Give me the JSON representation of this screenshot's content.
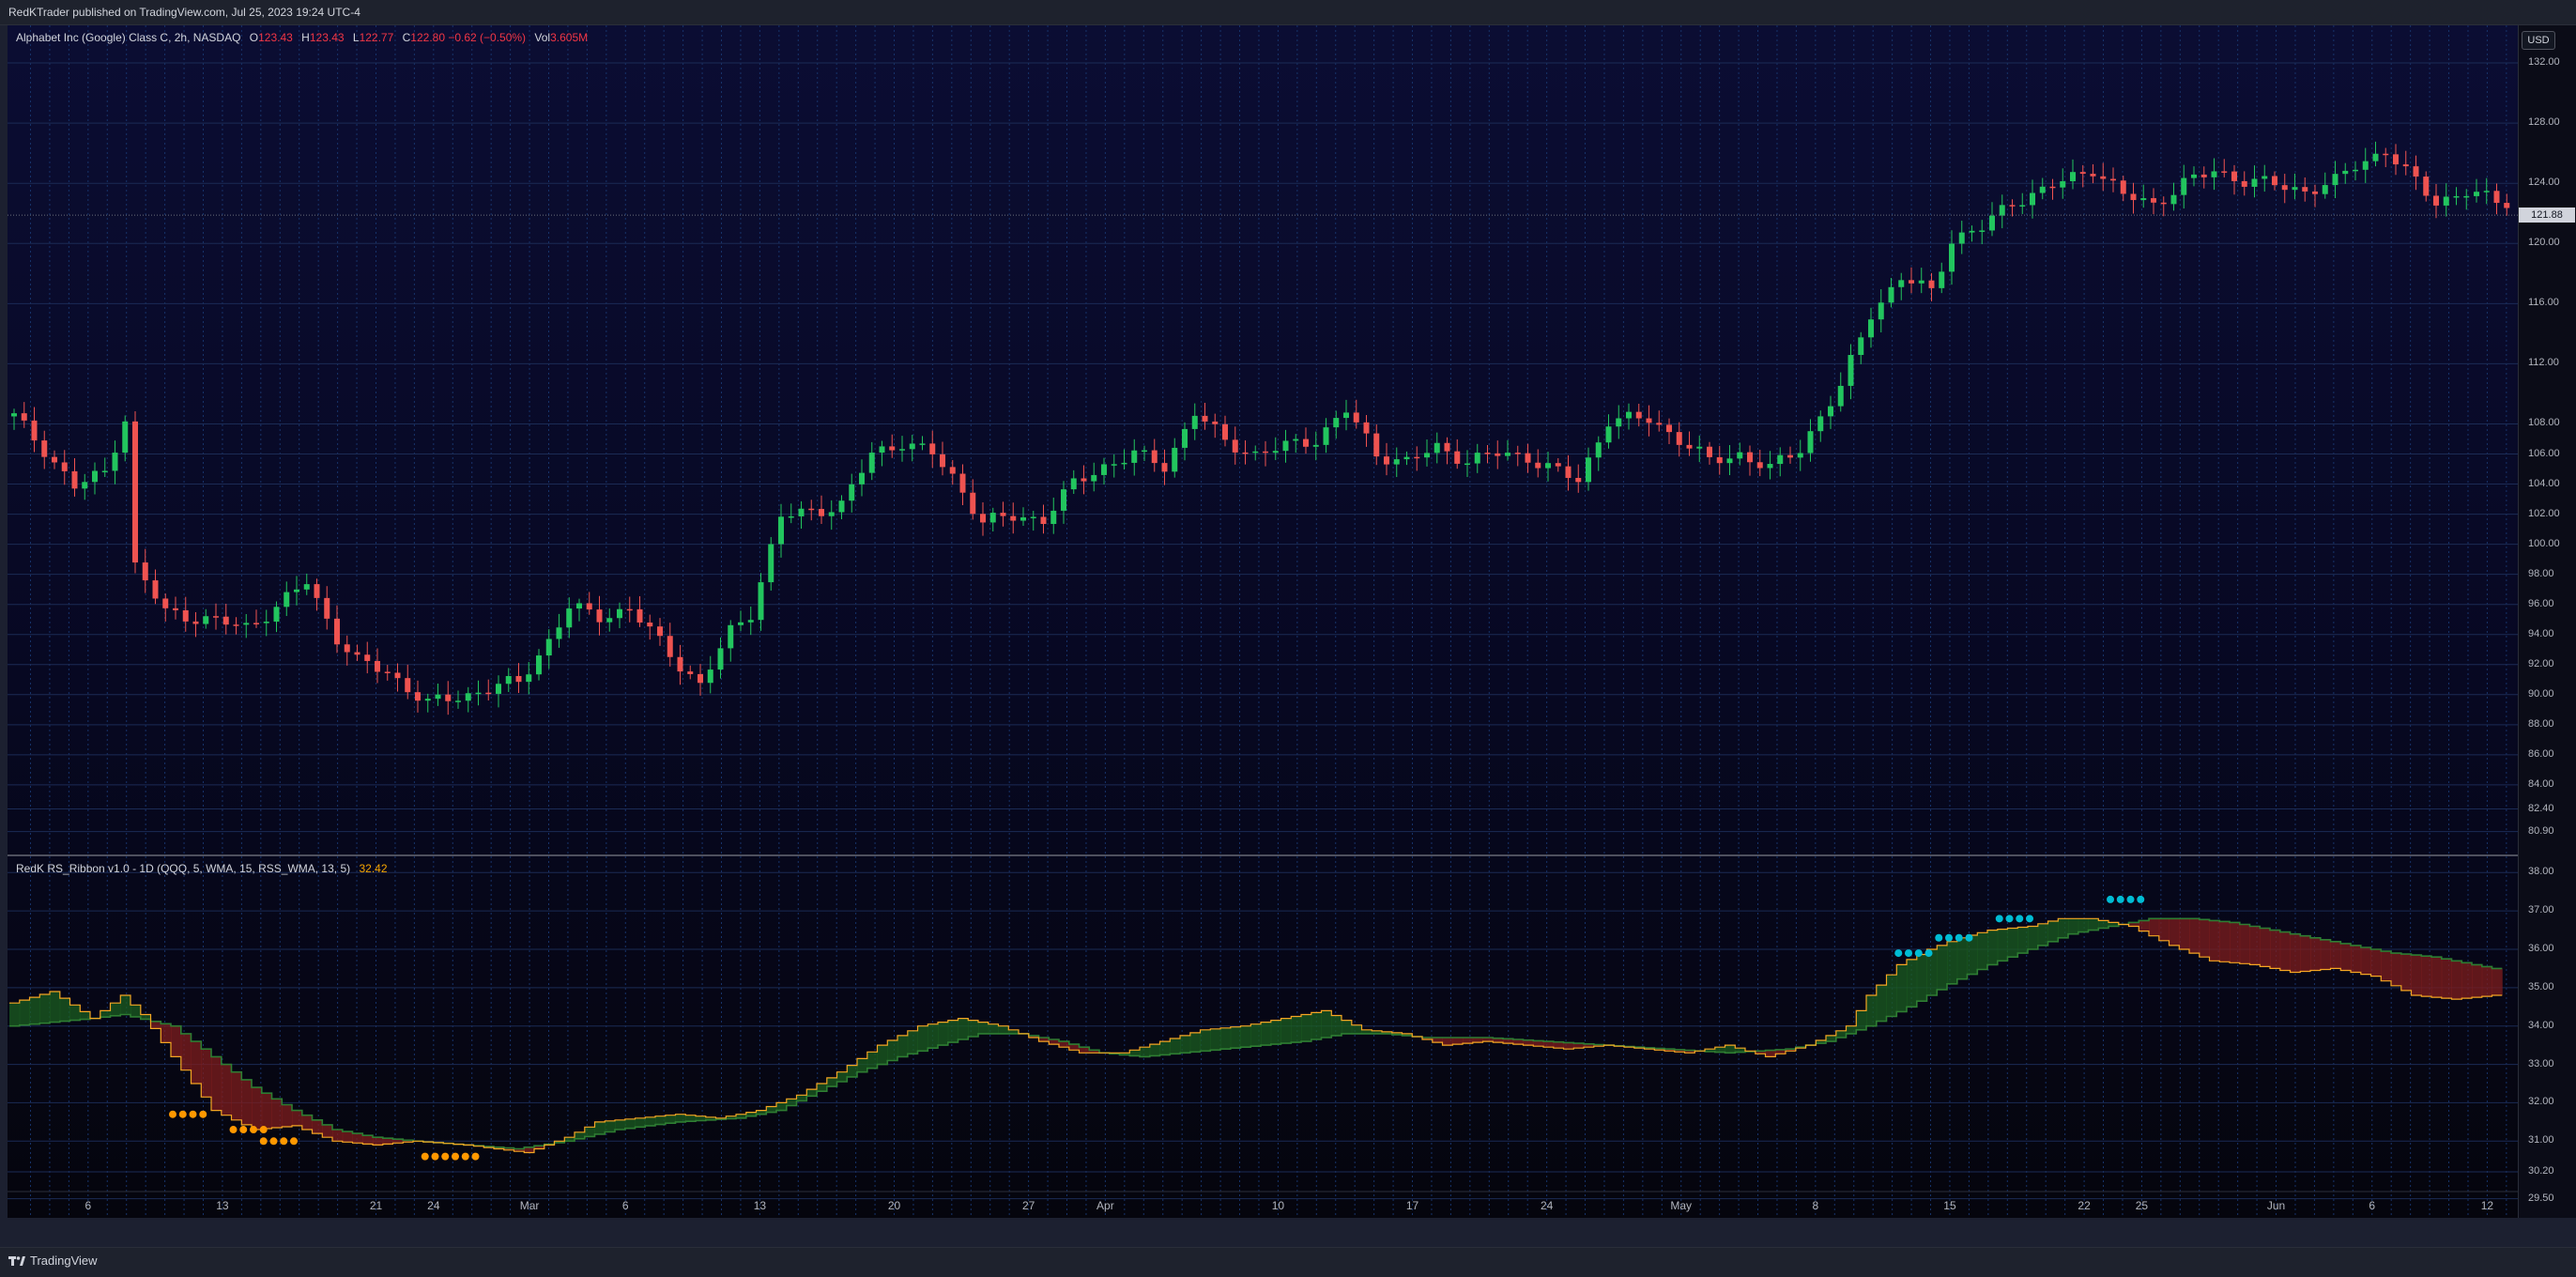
{
  "header": {
    "publisher_line": "RedKTrader published on TradingView.com, Jul 25, 2023 19:24 UTC-4"
  },
  "price_legend": {
    "symbol": "Alphabet Inc (Google) Class C, 2h, NASDAQ",
    "o_label": "O",
    "o_value": "123.43",
    "h_label": "H",
    "h_value": "123.43",
    "l_label": "L",
    "l_value": "122.77",
    "c_label": "C",
    "c_value": "122.80 −0.62 (−0.50%)",
    "vol_label": "Vol",
    "vol_value": "3.605M"
  },
  "indicator_legend": {
    "name": "RedK RS_Ribbon v1.0 - 1D (QQQ, 5, WMA, 15, RSS_WMA, 13, 5)",
    "value": "32.42"
  },
  "currency_button": "USD",
  "last_price_tag": "121.88",
  "footer": {
    "brand": "TradingView"
  },
  "colors": {
    "up_candle": "#26a69a",
    "up_candle_bright": "#22c55e",
    "down_candle": "#ef5350",
    "ribbon_bull": "#1b5e20",
    "ribbon_bear": "#7f1d1d",
    "fast_line": "#f5a623",
    "signal_orange": "#ff9800",
    "signal_cyan": "#00bcd4"
  },
  "chart_data": [
    {
      "type": "candlestick",
      "title": "Alphabet Inc (Google) Class C, 2h, NASDAQ",
      "ylim": [
        79.5,
        134.5
      ],
      "y_ticks": [
        "132.00",
        "128.00",
        "124.00",
        "120.00",
        "116.00",
        "112.00",
        "108.00",
        "106.00",
        "104.00",
        "102.00",
        "100.00",
        "98.00",
        "96.00",
        "94.00",
        "92.00",
        "90.00",
        "88.00",
        "86.00",
        "84.00",
        "82.40",
        "80.90"
      ],
      "x_ticks": [
        "6",
        "13",
        "21",
        "24",
        "Mar",
        "6",
        "13",
        "20",
        "27",
        "Apr",
        "10",
        "17",
        "24",
        "May",
        "8",
        "15",
        "22",
        "25",
        "Jun",
        "6",
        "12"
      ],
      "last_price": 121.88,
      "series": [
        {
          "name": "close",
          "points": [
            [
              0,
              108.5
            ],
            [
              3,
              106.3
            ],
            [
              6,
              103.8
            ],
            [
              9,
              104.8
            ],
            [
              11,
              108.4
            ],
            [
              12,
              98.5
            ],
            [
              15,
              95.5
            ],
            [
              19,
              95.0
            ],
            [
              23,
              94.5
            ],
            [
              26,
              95.8
            ],
            [
              29,
              97.5
            ],
            [
              32,
              93.8
            ],
            [
              34,
              92.2
            ],
            [
              37,
              91.5
            ],
            [
              41,
              89.4
            ],
            [
              45,
              90.0
            ],
            [
              48,
              90.6
            ],
            [
              50,
              90.8
            ],
            [
              53,
              93.6
            ],
            [
              55,
              95.8
            ],
            [
              58,
              95.2
            ],
            [
              61,
              95.7
            ],
            [
              64,
              93.5
            ],
            [
              66,
              92.0
            ],
            [
              68,
              90.6
            ],
            [
              71,
              94.2
            ],
            [
              73,
              95.5
            ],
            [
              76,
              101.8
            ],
            [
              79,
              102.2
            ],
            [
              82,
              102.6
            ],
            [
              85,
              106.0
            ],
            [
              88,
              106.8
            ],
            [
              91,
              106.0
            ],
            [
              93,
              104.5
            ],
            [
              96,
              101.5
            ],
            [
              99,
              101.8
            ],
            [
              102,
              101.7
            ],
            [
              105,
              104.0
            ],
            [
              108,
              105.2
            ],
            [
              111,
              106.0
            ],
            [
              114,
              105.2
            ],
            [
              117,
              108.8
            ],
            [
              120,
              106.8
            ],
            [
              123,
              106.0
            ],
            [
              126,
              106.5
            ],
            [
              129,
              107.0
            ],
            [
              132,
              108.9
            ],
            [
              135,
              106.0
            ],
            [
              138,
              105.5
            ],
            [
              141,
              106.4
            ],
            [
              144,
              105.6
            ],
            [
              147,
              106.0
            ],
            [
              150,
              105.8
            ],
            [
              153,
              104.8
            ],
            [
              155,
              104.2
            ],
            [
              158,
              108.3
            ],
            [
              162,
              108.3
            ],
            [
              165,
              107.0
            ],
            [
              168,
              105.5
            ],
            [
              171,
              106.0
            ],
            [
              174,
              105.0
            ],
            [
              177,
              106.4
            ],
            [
              179,
              108.5
            ],
            [
              181,
              110.4
            ],
            [
              184,
              115.4
            ],
            [
              187,
              117.7
            ],
            [
              190,
              116.8
            ],
            [
              192,
              120.3
            ],
            [
              195,
              121.0
            ],
            [
              198,
              122.8
            ],
            [
              201,
              123.5
            ],
            [
              204,
              124.4
            ],
            [
              206,
              125.0
            ],
            [
              209,
              123.2
            ],
            [
              212,
              122.6
            ],
            [
              215,
              124.0
            ],
            [
              218,
              124.8
            ],
            [
              221,
              124.2
            ],
            [
              224,
              123.9
            ],
            [
              227,
              123.5
            ],
            [
              230,
              124.1
            ],
            [
              232,
              125.2
            ],
            [
              235,
              126.2
            ],
            [
              237,
              124.7
            ],
            [
              240,
              122.8
            ],
            [
              243,
              123.4
            ],
            [
              246,
              122.8
            ]
          ]
        }
      ]
    },
    {
      "type": "area",
      "title": "RedK RS_Ribbon v1.0 - 1D (QQQ, 5, WMA, 15, RSS_WMA, 13, 5)",
      "ylim": [
        29.0,
        38.35
      ],
      "y_ticks": [
        "38.00",
        "37.00",
        "36.00",
        "35.00",
        "34.00",
        "33.00",
        "32.00",
        "31.00",
        "30.20",
        "29.50"
      ],
      "current_value": 32.42,
      "series": [
        {
          "name": "fast",
          "points": [
            [
              0,
              34.6
            ],
            [
              4,
              34.9
            ],
            [
              8,
              34.2
            ],
            [
              11,
              34.8
            ],
            [
              13,
              34.3
            ],
            [
              16,
              33.2
            ],
            [
              20,
              31.8
            ],
            [
              24,
              31.3
            ],
            [
              28,
              31.4
            ],
            [
              32,
              31.0
            ],
            [
              36,
              30.9
            ],
            [
              40,
              31.0
            ],
            [
              45,
              30.9
            ],
            [
              48,
              30.8
            ],
            [
              51,
              30.7
            ],
            [
              55,
              31.1
            ],
            [
              58,
              31.5
            ],
            [
              62,
              31.6
            ],
            [
              66,
              31.7
            ],
            [
              70,
              31.6
            ],
            [
              74,
              31.8
            ],
            [
              78,
              32.2
            ],
            [
              82,
              32.8
            ],
            [
              86,
              33.5
            ],
            [
              90,
              34.0
            ],
            [
              94,
              34.2
            ],
            [
              98,
              34.0
            ],
            [
              102,
              33.6
            ],
            [
              106,
              33.3
            ],
            [
              110,
              33.3
            ],
            [
              114,
              33.6
            ],
            [
              118,
              33.9
            ],
            [
              122,
              34.0
            ],
            [
              126,
              34.2
            ],
            [
              130,
              34.4
            ],
            [
              134,
              33.9
            ],
            [
              138,
              33.8
            ],
            [
              142,
              33.5
            ],
            [
              146,
              33.6
            ],
            [
              150,
              33.5
            ],
            [
              154,
              33.4
            ],
            [
              158,
              33.5
            ],
            [
              162,
              33.4
            ],
            [
              166,
              33.3
            ],
            [
              170,
              33.5
            ],
            [
              174,
              33.2
            ],
            [
              178,
              33.5
            ],
            [
              182,
              34.0
            ],
            [
              184,
              34.8
            ],
            [
              187,
              35.6
            ],
            [
              190,
              36.0
            ],
            [
              193,
              36.3
            ],
            [
              196,
              36.5
            ],
            [
              200,
              36.6
            ],
            [
              203,
              36.8
            ],
            [
              206,
              36.8
            ],
            [
              210,
              36.6
            ],
            [
              214,
              36.1
            ],
            [
              218,
              35.7
            ],
            [
              222,
              35.6
            ],
            [
              226,
              35.4
            ],
            [
              230,
              35.5
            ],
            [
              234,
              35.3
            ],
            [
              238,
              34.8
            ],
            [
              242,
              34.7
            ],
            [
              246,
              34.8
            ]
          ]
        },
        {
          "name": "slow",
          "points": [
            [
              0,
              34.0
            ],
            [
              8,
              34.2
            ],
            [
              11,
              34.3
            ],
            [
              16,
              34.0
            ],
            [
              20,
              33.2
            ],
            [
              24,
              32.4
            ],
            [
              28,
              31.8
            ],
            [
              32,
              31.3
            ],
            [
              36,
              31.1
            ],
            [
              40,
              31.0
            ],
            [
              45,
              30.9
            ],
            [
              50,
              30.8
            ],
            [
              55,
              31.0
            ],
            [
              60,
              31.3
            ],
            [
              66,
              31.5
            ],
            [
              72,
              31.6
            ],
            [
              76,
              31.8
            ],
            [
              80,
              32.3
            ],
            [
              84,
              32.8
            ],
            [
              88,
              33.2
            ],
            [
              92,
              33.5
            ],
            [
              96,
              33.8
            ],
            [
              100,
              33.8
            ],
            [
              104,
              33.6
            ],
            [
              108,
              33.3
            ],
            [
              112,
              33.2
            ],
            [
              116,
              33.3
            ],
            [
              120,
              33.4
            ],
            [
              124,
              33.5
            ],
            [
              128,
              33.6
            ],
            [
              132,
              33.8
            ],
            [
              136,
              33.8
            ],
            [
              140,
              33.7
            ],
            [
              146,
              33.7
            ],
            [
              152,
              33.6
            ],
            [
              158,
              33.5
            ],
            [
              164,
              33.4
            ],
            [
              170,
              33.3
            ],
            [
              176,
              33.4
            ],
            [
              180,
              33.6
            ],
            [
              184,
              34.0
            ],
            [
              188,
              34.5
            ],
            [
              192,
              35.1
            ],
            [
              196,
              35.6
            ],
            [
              200,
              36.0
            ],
            [
              204,
              36.4
            ],
            [
              208,
              36.6
            ],
            [
              212,
              36.8
            ],
            [
              216,
              36.8
            ],
            [
              220,
              36.7
            ],
            [
              224,
              36.5
            ],
            [
              228,
              36.3
            ],
            [
              232,
              36.1
            ],
            [
              236,
              35.9
            ],
            [
              240,
              35.8
            ],
            [
              246,
              35.5
            ]
          ]
        }
      ],
      "signals": [
        {
          "name": "orange",
          "color": "orange",
          "start": 16,
          "end": 19,
          "value": 31.7
        },
        {
          "name": "orange",
          "color": "orange",
          "start": 22,
          "end": 25,
          "value": 31.3
        },
        {
          "name": "orange",
          "color": "orange",
          "start": 25,
          "end": 28,
          "value": 31.0
        },
        {
          "name": "orange",
          "color": "orange",
          "start": 41,
          "end": 46,
          "value": 30.6
        },
        {
          "name": "cyan",
          "color": "cyan",
          "start": 187,
          "end": 190,
          "value": 35.9
        },
        {
          "name": "cyan",
          "color": "cyan",
          "start": 191,
          "end": 194,
          "value": 36.3
        },
        {
          "name": "cyan",
          "color": "cyan",
          "start": 197,
          "end": 200,
          "value": 36.8
        },
        {
          "name": "cyan",
          "color": "cyan",
          "start": 208,
          "end": 211,
          "value": 37.3
        }
      ]
    }
  ]
}
